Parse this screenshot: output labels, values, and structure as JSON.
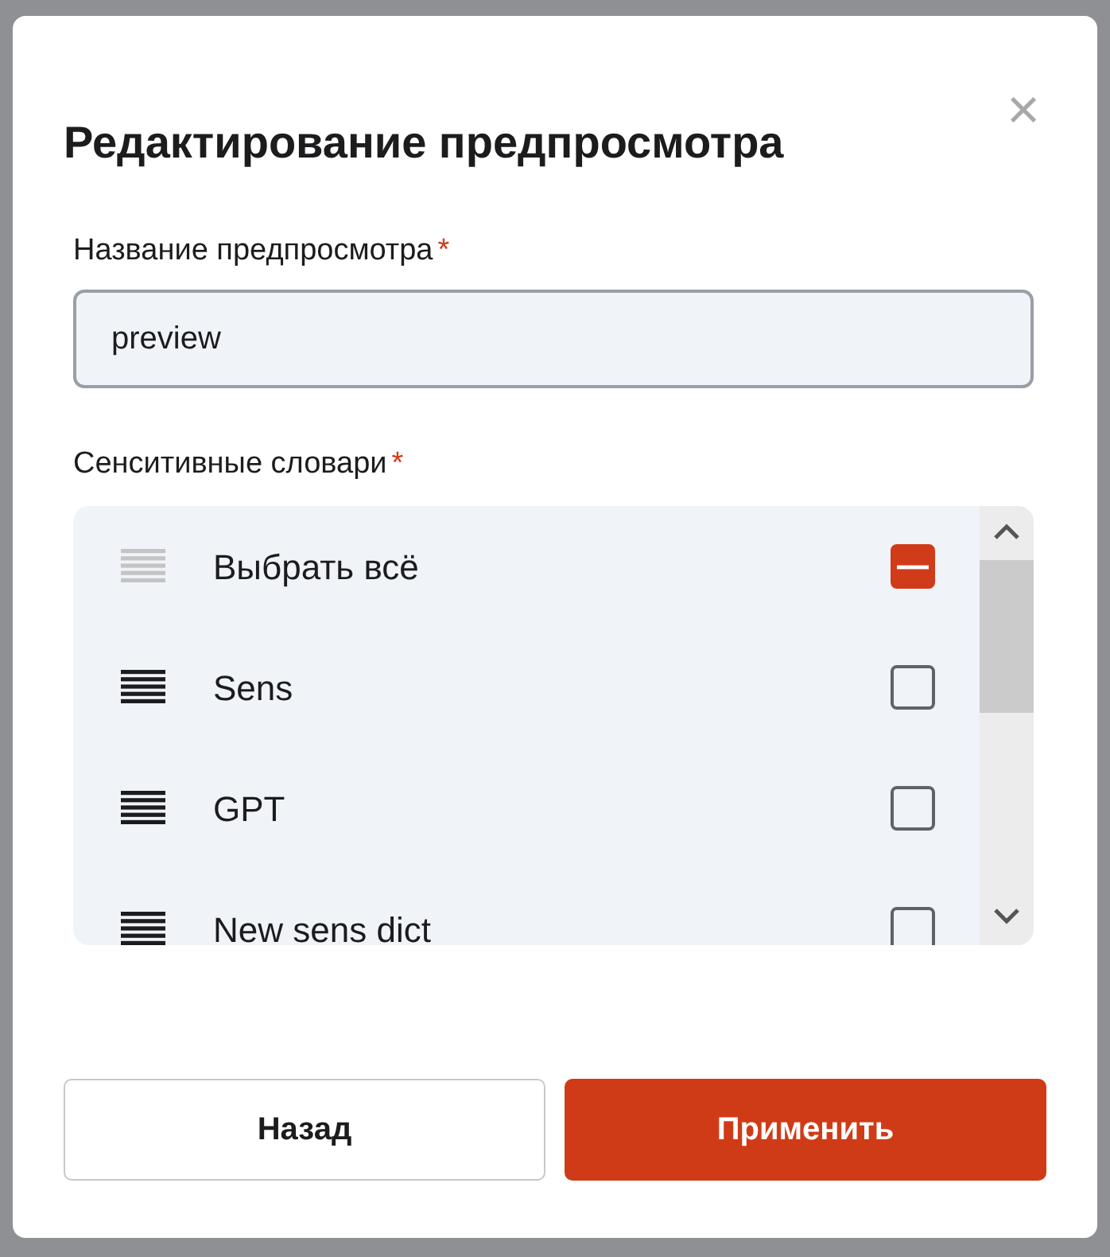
{
  "dialog": {
    "title": "Редактирование предпросмотра",
    "close": "×"
  },
  "name_field": {
    "label": "Название предпросмотра",
    "required_mark": "*",
    "value": "preview"
  },
  "dictionaries": {
    "label": "Сенситивные словари",
    "required_mark": "*",
    "items": [
      {
        "kind": "select_all",
        "label": "Выбрать всё",
        "indeterminate": true
      },
      {
        "kind": "item",
        "label": "Sens",
        "checked": false,
        "indeterminate": false
      },
      {
        "kind": "item",
        "label": "GPT",
        "checked": false,
        "indeterminate": false
      },
      {
        "kind": "item",
        "label": "New sens dict",
        "checked": false,
        "indeterminate": false
      }
    ]
  },
  "buttons": [
    {
      "kind": "secondary",
      "label": "Назад"
    },
    {
      "kind": "primary",
      "label": "Применить"
    }
  ]
}
